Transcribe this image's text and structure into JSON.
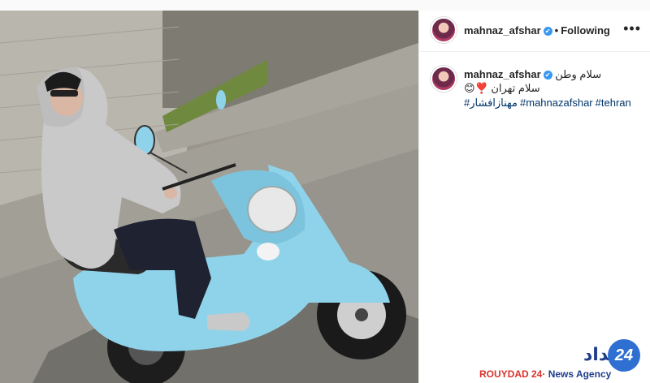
{
  "post": {
    "username": "mahnaz_afshar",
    "verified_glyph": "✔",
    "separator": "•",
    "follow_status": "Following",
    "more_glyph": "•••"
  },
  "caption": {
    "username": "mahnaz_afshar",
    "line1": "سلام وطن",
    "line2": "سلام تهران ❣️😊",
    "hashtags": [
      "#مهنازافشار",
      "#mahnazafshar",
      "#tehran"
    ]
  },
  "watermark": {
    "brand": "ROUYDAD 24",
    "sep": "·",
    "subtitle": "News Agency",
    "logo_word": "رویداد",
    "logo_number": "24"
  },
  "colors": {
    "scooter": "#8fd3ea",
    "link": "#003569",
    "verified": "#3897f0"
  },
  "icons": {
    "more": "more-options-icon",
    "verified": "verified-badge-icon",
    "avatar": "profile-avatar"
  }
}
